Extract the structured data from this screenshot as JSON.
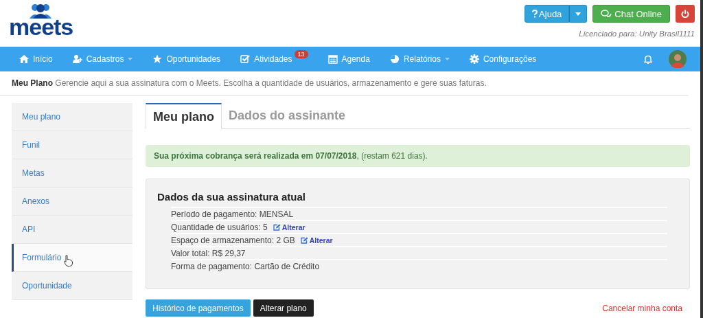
{
  "header": {
    "logo": "meets",
    "help_button": "Ajuda",
    "chat_button": "Chat Online",
    "license": "Licenciado para: Unity Brasil1111"
  },
  "nav": [
    {
      "label": "Início",
      "kind": "home",
      "dropdown": false
    },
    {
      "label": "Cadastros",
      "kind": "user-add",
      "dropdown": true
    },
    {
      "label": "Oportunidades",
      "kind": "star",
      "dropdown": false
    },
    {
      "label": "Atividades",
      "kind": "check",
      "dropdown": false,
      "badge": "13"
    },
    {
      "label": "Agenda",
      "kind": "calendar",
      "dropdown": false
    },
    {
      "label": "Relatórios",
      "kind": "pie",
      "dropdown": true
    },
    {
      "label": "Configurações",
      "kind": "gear",
      "dropdown": false
    }
  ],
  "breadcrumb": {
    "title": "Meu Plano",
    "description": "Gerencie aqui a sua assinatura com o Meets. Escolha a quantidade de usuários, armazenamento e gere suas faturas."
  },
  "sidebar": [
    {
      "label": "Meu plano",
      "selected": false
    },
    {
      "label": "Funil",
      "selected": false
    },
    {
      "label": "Metas",
      "selected": false
    },
    {
      "label": "Anexos",
      "selected": false
    },
    {
      "label": "API",
      "selected": false
    },
    {
      "label": "Formulário",
      "selected": true
    },
    {
      "label": "Oportunidade",
      "selected": false
    }
  ],
  "tabs": [
    {
      "label": "Meu plano",
      "selected": true
    },
    {
      "label": "Dados do assinante",
      "selected": false
    }
  ],
  "alert": "**Sua próxima cobrança será realizada em 07/07/2018**, (restam 621 dias).",
  "subscription": {
    "title": "Dados da sua assinatura atual",
    "rows": [
      {
        "text": "Período de pagamento: MENSAL"
      },
      {
        "text": "Quantidade de usuários: 5",
        "link": "Alterar"
      },
      {
        "text": "Espaço de armazenamento: 2 GB",
        "link": "Alterar"
      },
      {
        "text": "Valor total: R$ 29,37"
      },
      {
        "text": "Forma de pagamento: Cartão de Crédito"
      }
    ]
  },
  "buttons": {
    "history": "Histórico de pagamentos",
    "change_plan": "Alterar plano",
    "cancel": "Cancelar minha conta"
  }
}
